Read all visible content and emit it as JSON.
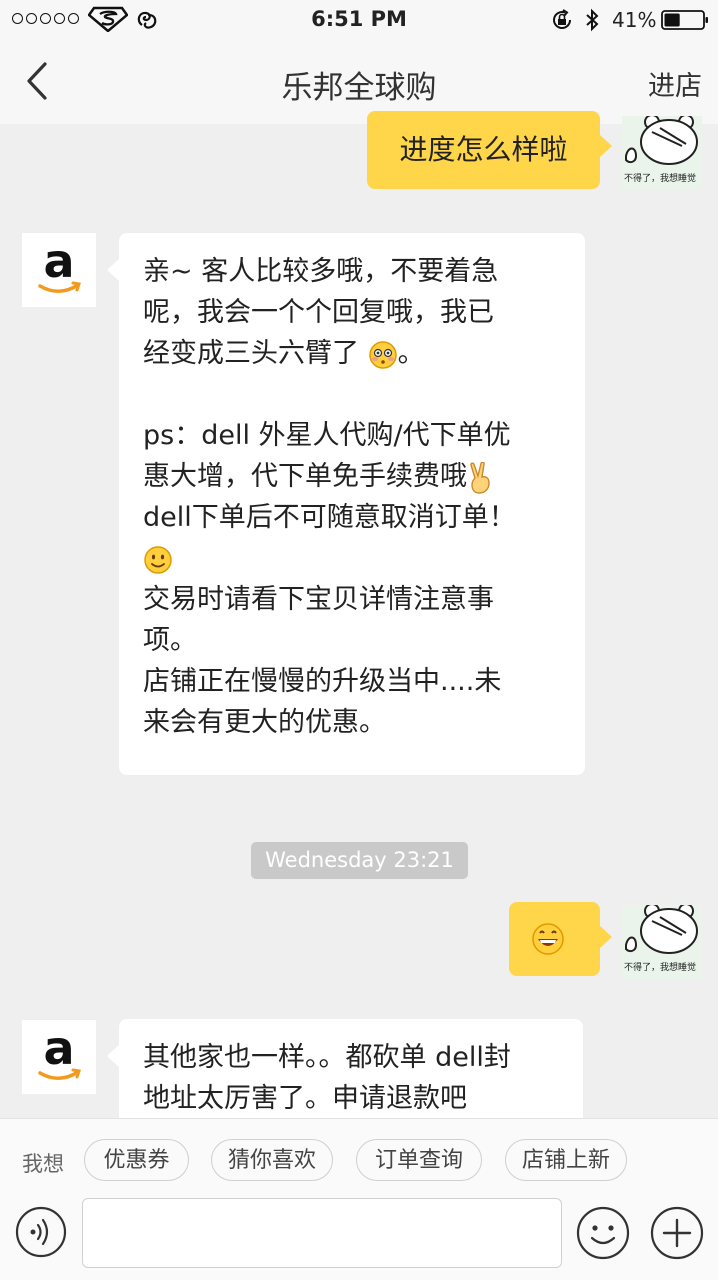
{
  "status_bar": {
    "time": "6:51 PM",
    "battery_percent": "41%",
    "battery_level": 0.41,
    "signal_dots": 5,
    "carrier_icon": "superman-logo-icon",
    "network_icon": "wifi-icon"
  },
  "nav": {
    "back_icon": "chevron-left-icon",
    "title": "乐邦全球购",
    "action": "进店"
  },
  "sticker": {
    "caption": "不得了，我想睡觉"
  },
  "messages": {
    "m1": {
      "text": "进度怎么样啦"
    },
    "m2": {
      "lines": [
        "亲~ 客人比较多哦，不要着急",
        "呢，我会一个个回复哦，我已",
        "经变成三头六臂了 ",
        "",
        "ps：dell 外星人代购/代下单优",
        "惠大增，代下单免手续费哦",
        "dell下单后不可随意取消订单！",
        "",
        "交易时请看下宝贝详情注意事",
        "项。",
        "店铺正在慢慢的升级当中....未",
        "来会有更大的优惠。"
      ],
      "emojis": [
        "flushed-face-icon",
        "victory-hand-icon",
        "slightly-smiling-face-icon"
      ]
    },
    "timestamp": "Wednesday 23:21",
    "m3": {
      "emoji": "grinning-face-icon"
    },
    "m4": {
      "lines": [
        "其他家也一样。。都砍单 dell封",
        "地址太厉害了。申请退款吧"
      ]
    }
  },
  "quick_reply": {
    "label": "我想",
    "chips": [
      "优惠券",
      "猜你喜欢",
      "订单查询",
      "店铺上新"
    ]
  },
  "input": {
    "placeholder": "",
    "voice_icon": "voice-icon",
    "emoji_icon": "smiley-icon",
    "plus_icon": "plus-icon"
  },
  "colors": {
    "outgoing_bubble": "#ffd54a",
    "incoming_bubble": "#ffffff",
    "chat_background": "#efefef",
    "amazon_orange": "#f39a1e"
  }
}
